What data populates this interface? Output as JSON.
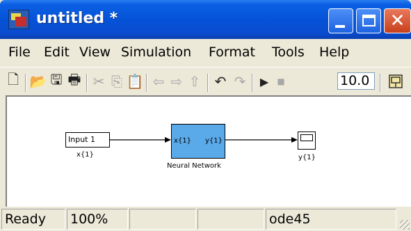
{
  "window": {
    "title": "untitled *"
  },
  "menubar": {
    "items": [
      "File",
      "Edit",
      "View",
      "Simulation",
      "Format",
      "Tools",
      "Help"
    ]
  },
  "toolbar": {
    "stop_time": "10.0",
    "icons": [
      "new-icon",
      "open-icon",
      "save-icon",
      "print-icon",
      "cut-icon",
      "copy-icon",
      "paste-icon",
      "back-icon",
      "forward-icon",
      "up-icon",
      "undo-icon",
      "redo-icon",
      "start-simulation-icon",
      "stop-simulation-icon",
      "library-browser-icon"
    ]
  },
  "model": {
    "inport": {
      "text": "Input 1",
      "label": "x{1}"
    },
    "neural_network": {
      "in_port": "x{1}",
      "out_port": "y{1}",
      "label": "Neural Network"
    },
    "scope": {
      "label": "y{1}"
    }
  },
  "status": {
    "state": "Ready",
    "zoom": "100%",
    "solver": "ode45"
  },
  "colors": {
    "titlebar": "#0553d8",
    "block_fill": "#5aa9e8",
    "close_button": "#c8401b"
  }
}
